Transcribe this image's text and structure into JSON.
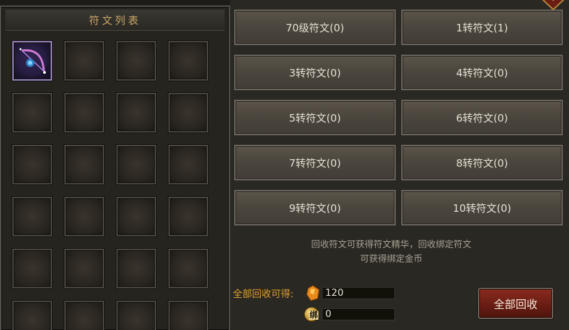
{
  "left_panel": {
    "title": "符文列表",
    "slots": [
      {
        "filled": true,
        "item": "bow-rune-icon"
      },
      {
        "filled": false
      },
      {
        "filled": false
      },
      {
        "filled": false
      },
      {
        "filled": false
      },
      {
        "filled": false
      },
      {
        "filled": false
      },
      {
        "filled": false
      },
      {
        "filled": false
      },
      {
        "filled": false
      },
      {
        "filled": false
      },
      {
        "filled": false
      },
      {
        "filled": false
      },
      {
        "filled": false
      },
      {
        "filled": false
      },
      {
        "filled": false
      },
      {
        "filled": false
      },
      {
        "filled": false
      },
      {
        "filled": false
      },
      {
        "filled": false
      },
      {
        "filled": false
      },
      {
        "filled": false
      },
      {
        "filled": false
      },
      {
        "filled": false
      }
    ]
  },
  "rune_buttons": [
    {
      "label": "70级符文(0)"
    },
    {
      "label": "1转符文(1)"
    },
    {
      "label": "3转符文(0)"
    },
    {
      "label": "4转符文(0)"
    },
    {
      "label": "5转符文(0)"
    },
    {
      "label": "6转符文(0)"
    },
    {
      "label": "7转符文(0)"
    },
    {
      "label": "8转符文(0)"
    },
    {
      "label": "9转符文(0)"
    },
    {
      "label": "10转符文(0)"
    }
  ],
  "hint": {
    "line1": "回收符文可获得符文精华，回收绑定符文",
    "line2": "可获得绑定金币"
  },
  "recycle": {
    "label": "全部回收可得:",
    "essence_value": "120",
    "bound_gold_tag": "绑",
    "bound_gold_value": "0",
    "button_label": "全部回收"
  },
  "colors": {
    "title_gold": "#c9a667",
    "label_orange": "#e0a12e",
    "button_red": "#6a1d14"
  }
}
